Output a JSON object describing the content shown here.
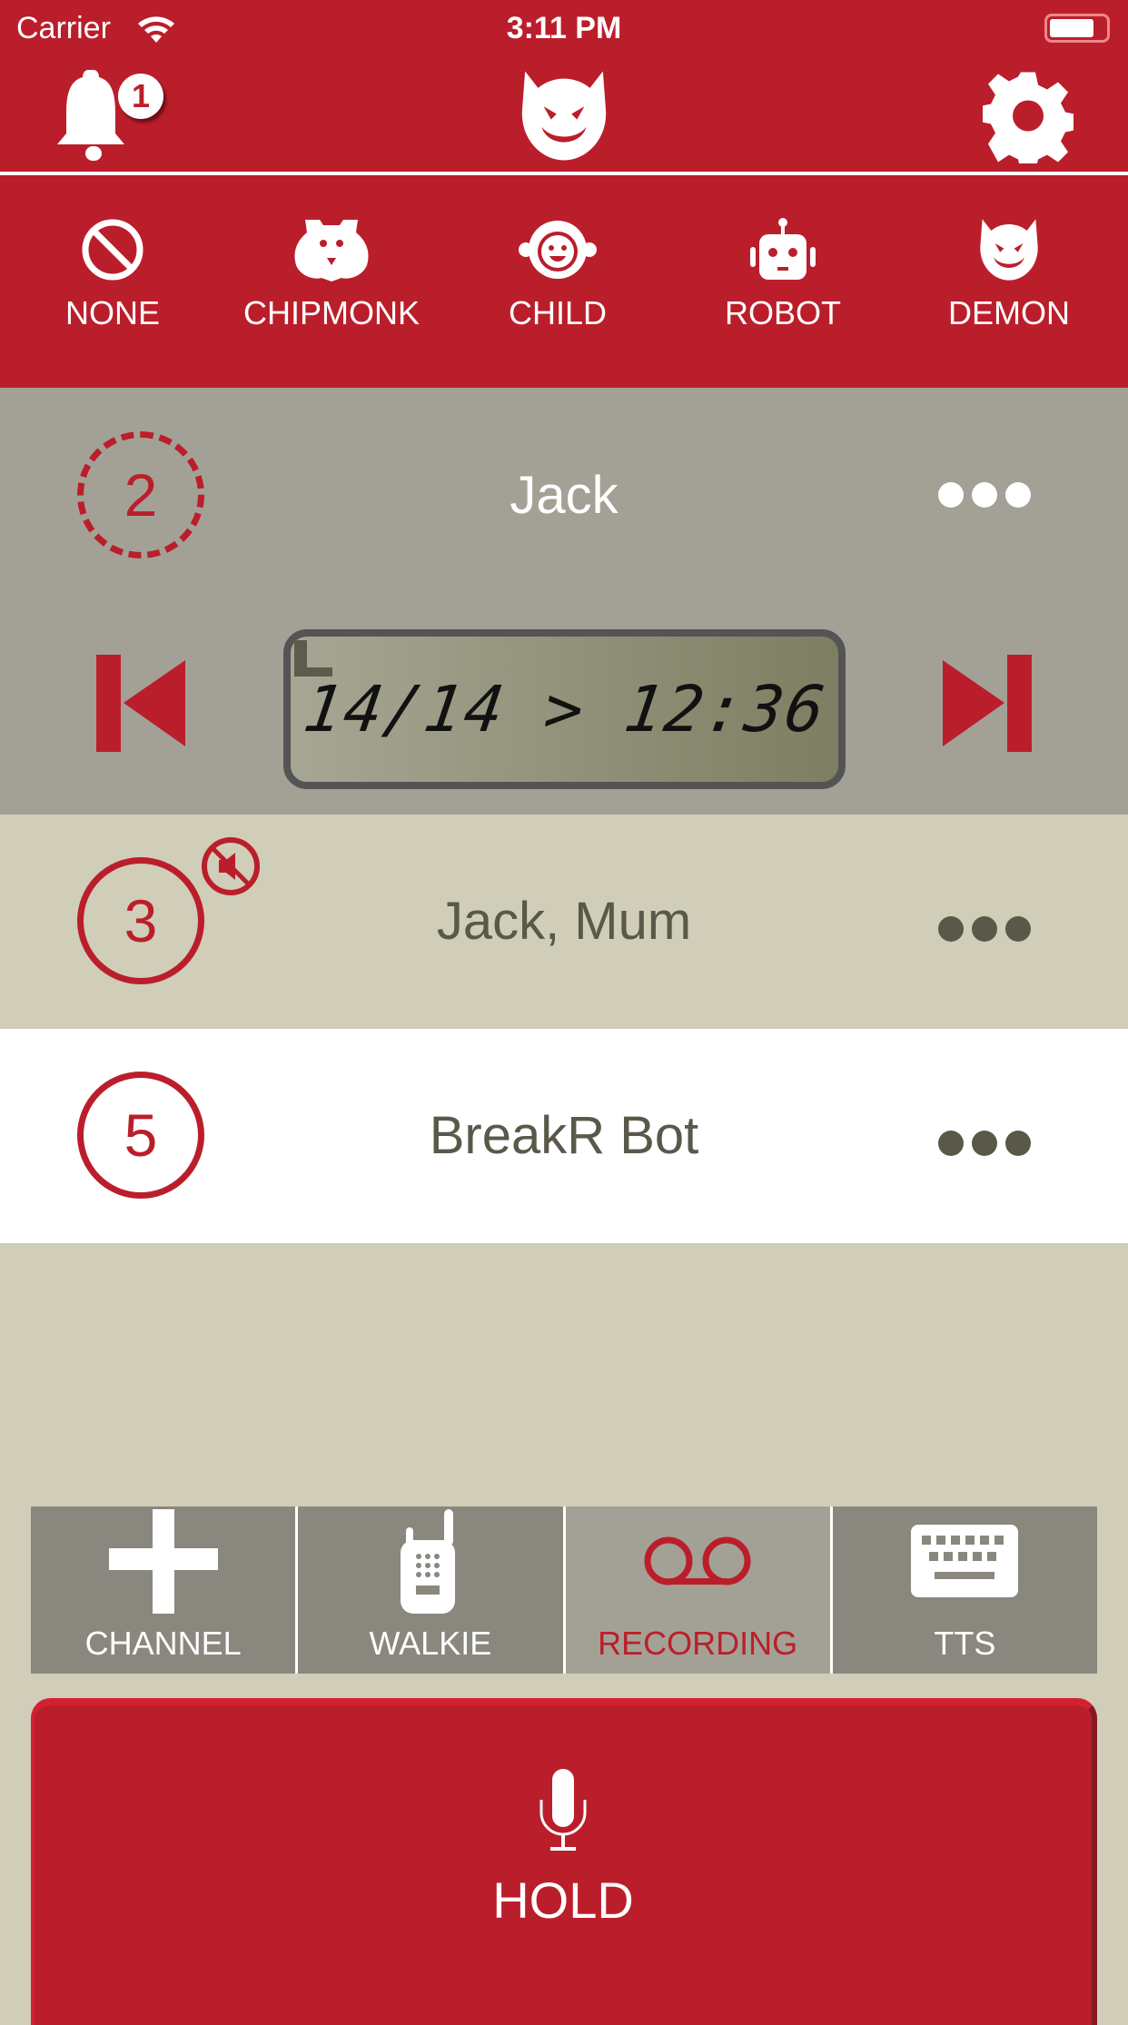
{
  "status_bar": {
    "carrier": "Carrier",
    "time": "3:11 PM"
  },
  "header": {
    "notification_count": "1",
    "logo_icon": "demon-face-icon"
  },
  "voices": [
    {
      "label": "NONE",
      "icon": "none-icon"
    },
    {
      "label": "CHIPMONK",
      "icon": "chipmunk-icon"
    },
    {
      "label": "CHILD",
      "icon": "child-icon"
    },
    {
      "label": "ROBOT",
      "icon": "robot-icon"
    },
    {
      "label": "DEMON",
      "icon": "demon-icon"
    }
  ],
  "channels": [
    {
      "number": "2",
      "name": "Jack",
      "selected": true
    },
    {
      "number": "3",
      "name": "Jack, Mum",
      "muted": true
    },
    {
      "number": "5",
      "name": "BreakR Bot"
    }
  ],
  "player": {
    "display": "14/14 > 12:36"
  },
  "tabs": [
    {
      "label": "CHANNEL"
    },
    {
      "label": "WALKIE"
    },
    {
      "label": "RECORDING",
      "active": true
    },
    {
      "label": "TTS"
    }
  ],
  "hold_button": {
    "label": "HOLD"
  },
  "colors": {
    "accent": "#bb1e2b",
    "selected_row": "#a3a195",
    "row": "#d0cdb9",
    "tab": "#8a877e"
  }
}
